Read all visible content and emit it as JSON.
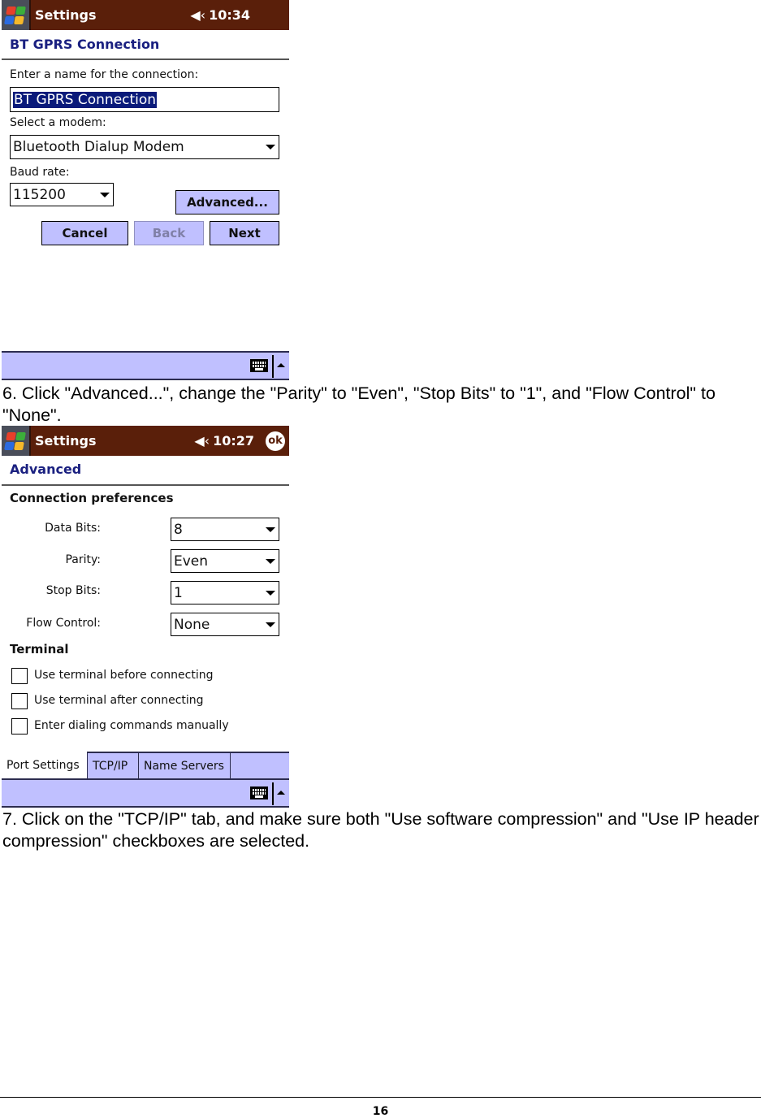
{
  "screen1": {
    "titlebar": {
      "title": "Settings",
      "speaker_icon": "◀‹",
      "time": "10:34"
    },
    "heading": "BT GPRS Connection",
    "name_label": "Enter a name for the connection:",
    "name_value": "BT GPRS Connection",
    "modem_label": "Select a modem:",
    "modem_value": "Bluetooth Dialup Modem",
    "baud_label": "Baud rate:",
    "baud_value": "115200",
    "advanced_button": "Advanced...",
    "cancel_button": "Cancel",
    "back_button": "Back",
    "next_button": "Next"
  },
  "step6": "6. Click \"Advanced...\", change the \"Parity\" to \"Even\", \"Stop Bits\" to \"1\", and \"Flow Control\" to \"None\".",
  "screen2": {
    "titlebar": {
      "title": "Settings",
      "speaker_icon": "◀‹",
      "time": "10:27",
      "ok_button": "ok"
    },
    "heading": "Advanced",
    "section1": "Connection preferences",
    "fields": [
      {
        "label": "Data Bits:",
        "value": "8"
      },
      {
        "label": "Parity:",
        "value": "Even"
      },
      {
        "label": "Stop Bits:",
        "value": "1"
      },
      {
        "label": "Flow Control:",
        "value": "None"
      }
    ],
    "section2": "Terminal",
    "checkboxes": [
      {
        "label": "Use terminal before connecting",
        "checked": false
      },
      {
        "label": "Use terminal after connecting",
        "checked": false
      },
      {
        "label": "Enter dialing commands manually",
        "checked": false
      }
    ],
    "tabs": [
      {
        "label": "Port Settings",
        "active": true
      },
      {
        "label": "TCP/IP",
        "active": false
      },
      {
        "label": "Name Servers",
        "active": false
      }
    ]
  },
  "step7": "7. Click on the \"TCP/IP\" tab, and make sure both \"Use software compression\" and \"Use IP header compression\" checkboxes are selected.",
  "page_number": "16"
}
